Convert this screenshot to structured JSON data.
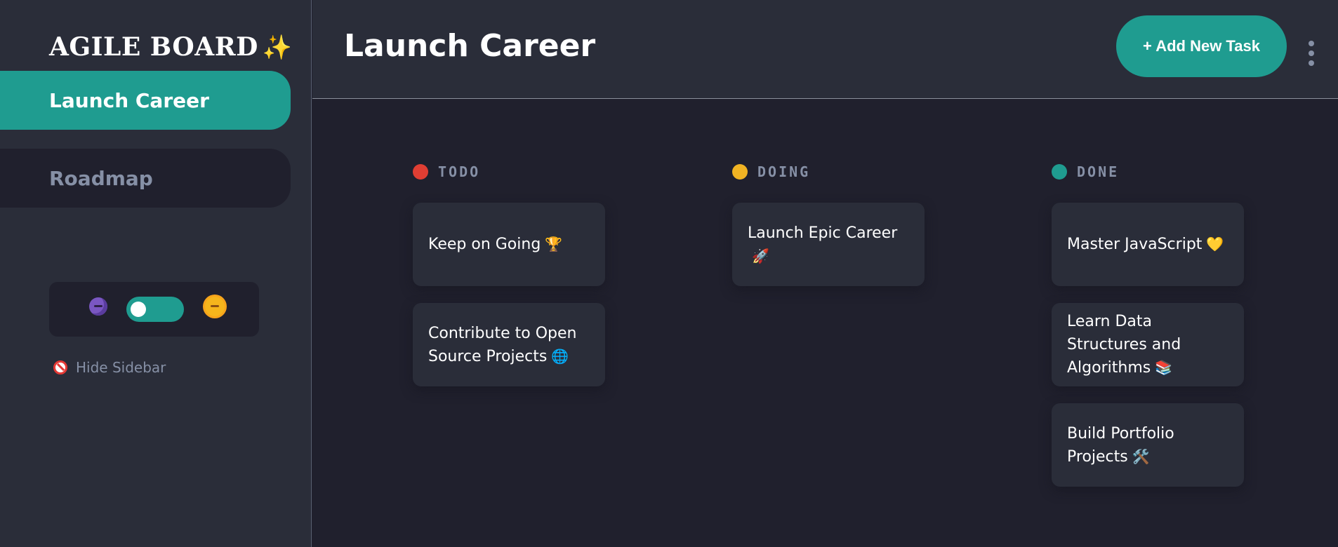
{
  "sidebar": {
    "brand": "AGILE BOARD",
    "brand_emoji": "✨",
    "boards": [
      {
        "label": "Launch Career",
        "active": true
      },
      {
        "label": "Roadmap",
        "active": false
      }
    ],
    "theme_toggle": {
      "dark_icon": "moon-face-icon",
      "light_icon": "sun-face-icon",
      "state": "dark"
    },
    "hide_sidebar_label": "Hide Sidebar",
    "hide_sidebar_icon": "no-entry-icon"
  },
  "header": {
    "title": "Launch Career",
    "add_task_label": "+ Add New Task",
    "menu_icon": "vertical-ellipsis-icon"
  },
  "columns": [
    {
      "name": "TODO",
      "color": "#e03e33",
      "cards": [
        {
          "text": "Keep on Going",
          "emoji": "🏆"
        },
        {
          "text": "Contribute to Open Source Projects",
          "emoji": "🌐"
        }
      ]
    },
    {
      "name": "DOING",
      "color": "#f0b323",
      "cards": [
        {
          "text": "Launch Epic Career",
          "emoji": "🚀"
        }
      ]
    },
    {
      "name": "DONE",
      "color": "#1f9c90",
      "cards": [
        {
          "text": "Master JavaScript",
          "emoji": "💛"
        },
        {
          "text": "Learn Data Structures and Algorithms",
          "emoji": "📚"
        },
        {
          "text": "Build Portfolio Projects",
          "emoji": "🛠️"
        }
      ]
    }
  ],
  "colors": {
    "accent": "#1f9c90",
    "sidebar_bg": "#2a2d39",
    "board_bg": "#20202d",
    "muted_text": "#8690a6"
  }
}
